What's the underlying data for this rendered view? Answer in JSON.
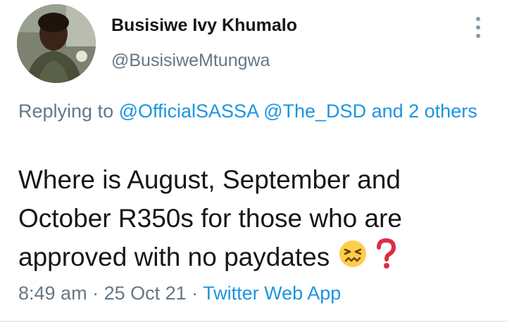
{
  "user": {
    "display_name": "Busisiwe Ivy Khumalo",
    "handle": "@BusisiweMtungwa"
  },
  "reply_context": {
    "prefix": "Replying to ",
    "mentions": [
      "@OfficialSASSA",
      "@The_DSD"
    ],
    "suffix": "and 2 others"
  },
  "tweet": {
    "text": "Where is August, September and October R350s for those who are approved with no paydates",
    "emojis": [
      "persevering-face",
      "red-question-mark"
    ]
  },
  "footer": {
    "time": "8:49 am",
    "separator": " · ",
    "date": "25 Oct 21",
    "source": "Twitter Web App"
  },
  "icons": {
    "more": "vertical-ellipsis-icon"
  },
  "colors": {
    "link": "#1b95e0",
    "secondary_text": "#657786",
    "primary_text": "#14171a"
  }
}
